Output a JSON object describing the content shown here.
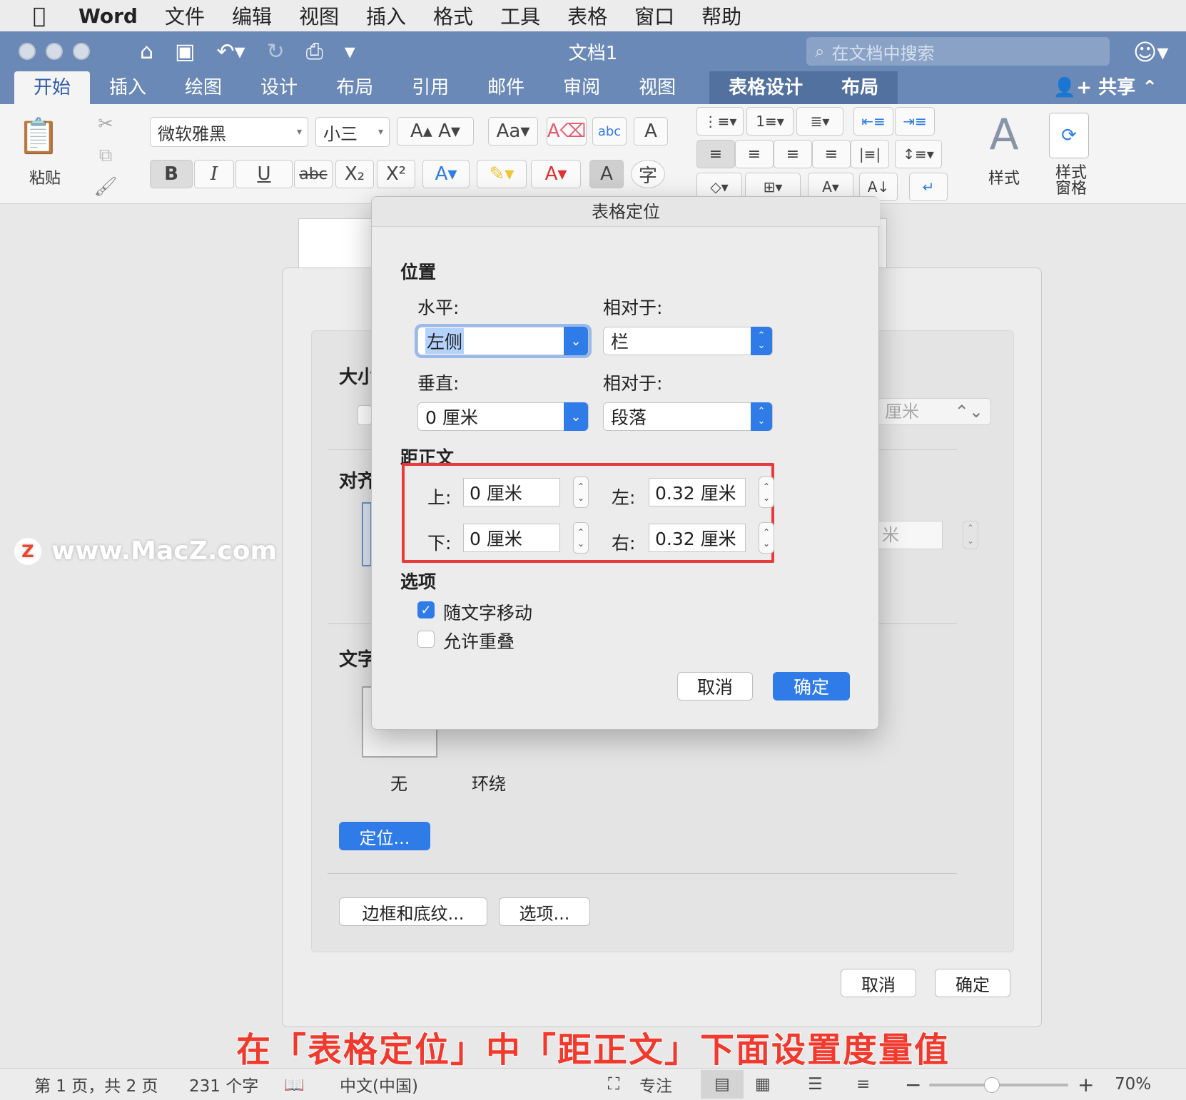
{
  "menubar": {
    "apple_icon": "apple-icon",
    "app": "Word",
    "items": [
      "文件",
      "编辑",
      "视图",
      "插入",
      "格式",
      "工具",
      "表格",
      "窗口",
      "帮助"
    ]
  },
  "titlebar": {
    "doc_title": "文档1",
    "search_placeholder": "在文档中搜索"
  },
  "tabs": {
    "items": [
      "开始",
      "插入",
      "绘图",
      "设计",
      "布局",
      "引用",
      "邮件",
      "审阅",
      "视图"
    ],
    "context": [
      "表格设计",
      "布局"
    ],
    "share": "共享"
  },
  "ribbon": {
    "paste": "粘贴",
    "font_name": "微软雅黑",
    "font_size": "小三",
    "bold": "B",
    "italic": "I",
    "underline": "U",
    "strike": "abc",
    "styles": "样式",
    "styles_pane": "样式\n窗格"
  },
  "bg_dialog": {
    "size_label": "大小",
    "align_label": "对齐",
    "wrap_label": "文字",
    "unit_partial_1": "厘米",
    "unit_partial_2": "米",
    "wrap_none": "无",
    "wrap_around": "环绕",
    "position_btn": "定位...",
    "borders_btn": "边框和底纹...",
    "options_btn": "选项...",
    "cancel": "取消",
    "ok": "确定"
  },
  "dialog": {
    "title": "表格定位",
    "position_section": "位置",
    "horizontal_label": "水平:",
    "horizontal_value": "左侧",
    "relative_label_1": "相对于:",
    "relative_value_1": "栏",
    "vertical_label": "垂直:",
    "vertical_value": "0 厘米",
    "relative_label_2": "相对于:",
    "relative_value_2": "段落",
    "distance_section": "距正文",
    "top_label": "上:",
    "top_value": "0 厘米",
    "bottom_label": "下:",
    "bottom_value": "0 厘米",
    "left_label": "左:",
    "left_value": "0.32 厘米",
    "right_label": "右:",
    "right_value": "0.32 厘米",
    "options_section": "选项",
    "move_with_text": "随文字移动",
    "move_with_text_checked": true,
    "allow_overlap": "允许重叠",
    "allow_overlap_checked": false,
    "cancel": "取消",
    "ok": "确定"
  },
  "watermark": {
    "logo": "Z",
    "text": "www.MacZ.com"
  },
  "caption": "在「表格定位」中「距正文」下面设置度量值",
  "statusbar": {
    "page": "第 1 页，共 2 页",
    "words": "231 个字",
    "language": "中文(中国)",
    "focus": "专注",
    "zoom": "70%",
    "zoom_level": 0.45
  },
  "colors": {
    "accent": "#2f7be8",
    "titlebar": "#6b89b6",
    "highlight_box": "#e83a3a",
    "caption": "#f03a2e"
  }
}
